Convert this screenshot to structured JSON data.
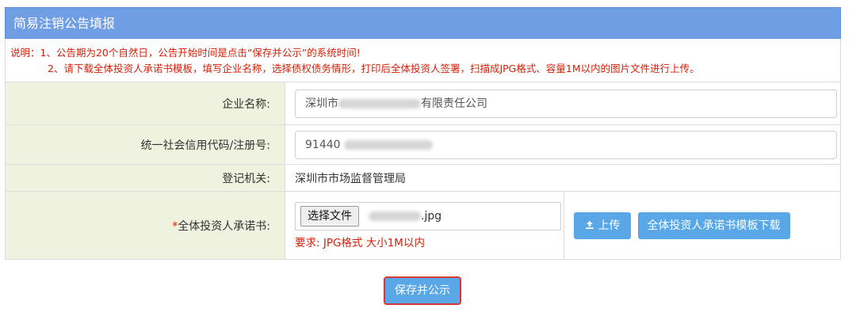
{
  "panel": {
    "title": "简易注销公告填报"
  },
  "notice": {
    "line1": "说明：1、公告期为20个自然日，公告开始时间是点击“保存并公示”的系统时间!",
    "line2": "2、请下载全体投资人承诺书模板，填写企业名称，选择债权债务情形，打印后全体投资人签署，扫描成JPG格式、容量1M以内的图片文件进行上传。"
  },
  "form": {
    "company_name": {
      "label": "企业名称:",
      "value_prefix": "深圳市",
      "value_suffix": "有限责任公司"
    },
    "credit_code": {
      "label": "统一社会信用代码/注册号:",
      "value_prefix": "91440"
    },
    "registration_authority": {
      "label": "登记机关:",
      "value": "深圳市市场监督管理局"
    },
    "commitment_letter": {
      "required_mark": "*",
      "label": "全体投资人承诺书:",
      "choose_file_label": "选择文件",
      "file_suffix": ".jpg",
      "hint": "要求: JPG格式 大小1M以内"
    }
  },
  "actions": {
    "upload_icon": "upload-icon",
    "upload_label": "上传",
    "template_download_label": "全体投资人承诺书模板下载",
    "save_publish_label": "保存并公示"
  },
  "colors": {
    "header_bg": "#6f9ee4",
    "notice_text": "#d81e06",
    "label_bg": "#eef2de",
    "button_blue": "#5aa7e8",
    "save_border": "#d9383a"
  }
}
